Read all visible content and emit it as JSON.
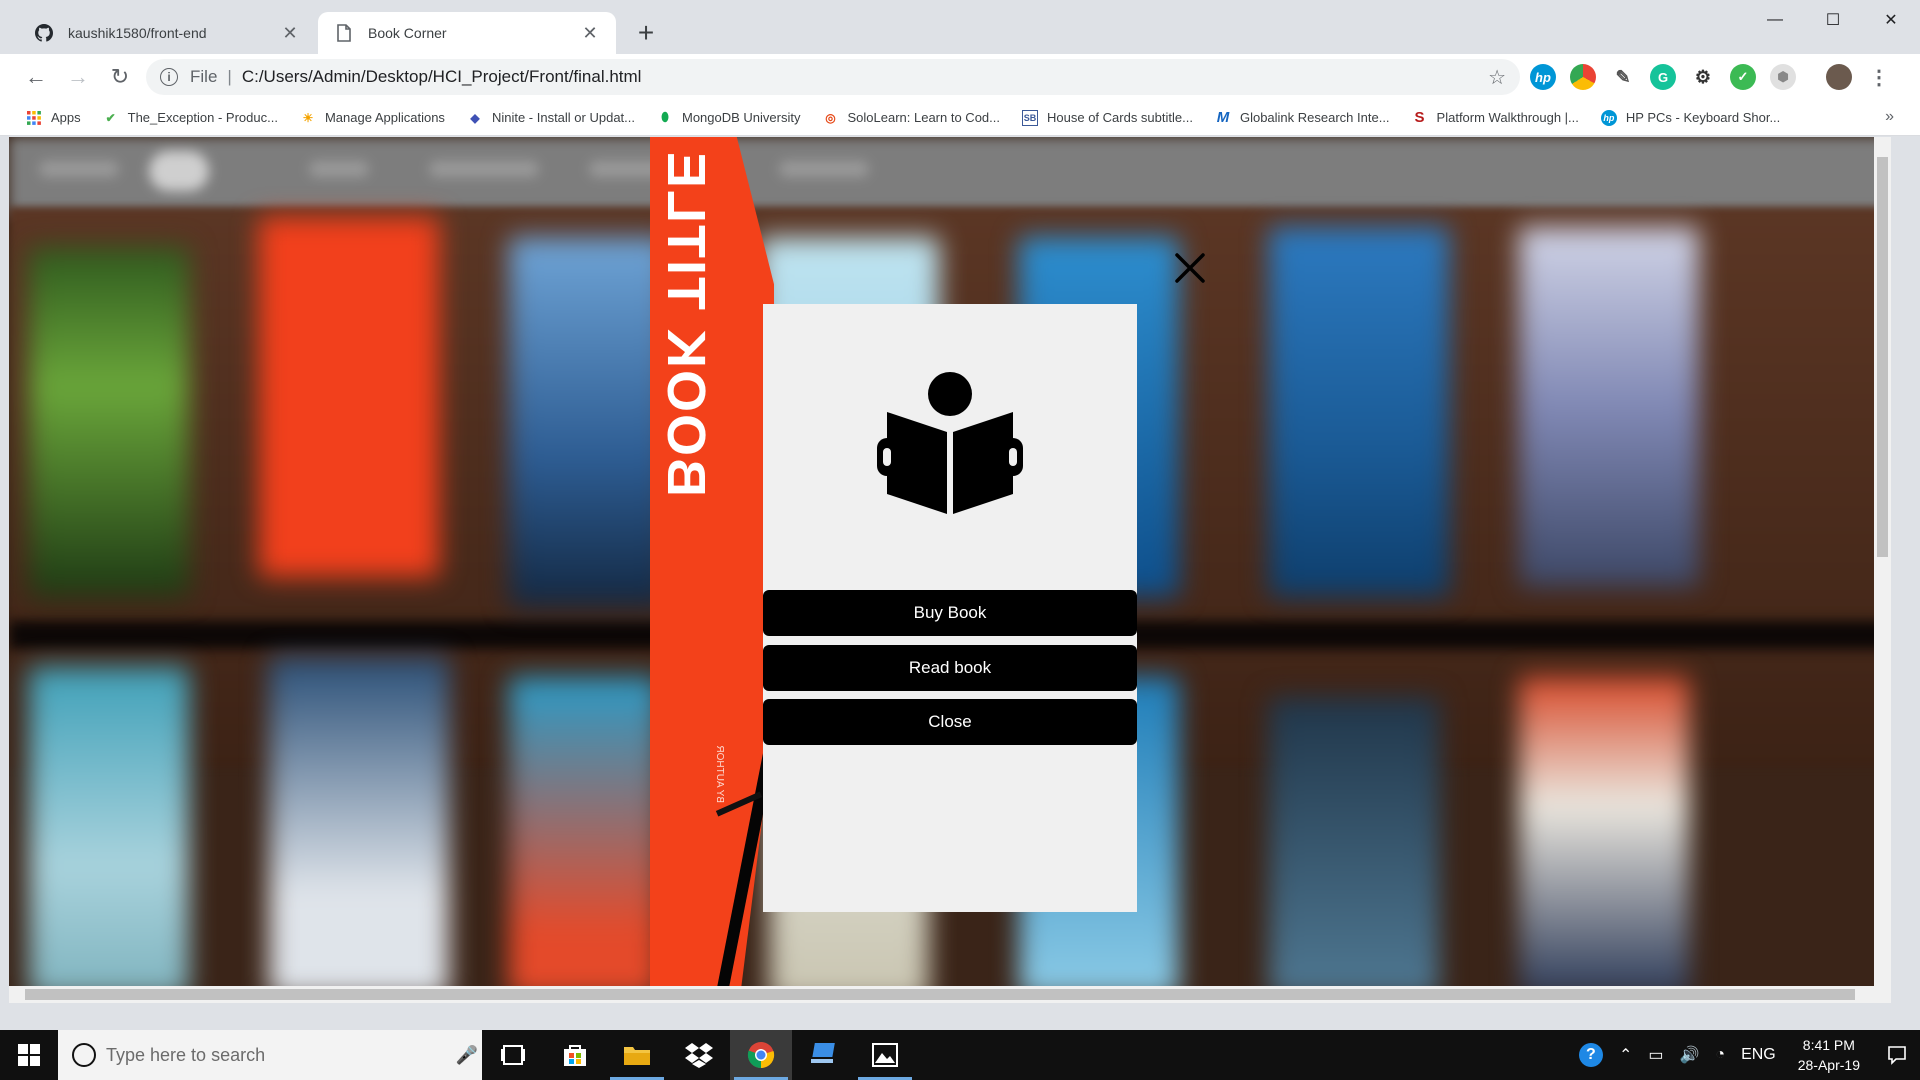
{
  "browser": {
    "tabs": [
      {
        "title": "kaushik1580/front-end",
        "icon": "github-icon"
      },
      {
        "title": "Book Corner",
        "icon": "page-icon"
      }
    ],
    "address": {
      "scheme": "File",
      "url": "C:/Users/Admin/Desktop/HCI_Project/Front/final.html"
    },
    "bookmarks": [
      {
        "label": "Apps",
        "icon": "apps-grid-icon"
      },
      {
        "label": "The_Exception - Produc...",
        "icon": "check-icon"
      },
      {
        "label": "Manage Applications",
        "icon": "sun-icon"
      },
      {
        "label": "Ninite - Install or Updat...",
        "icon": "ninite-icon"
      },
      {
        "label": "MongoDB University",
        "icon": "leaf-icon"
      },
      {
        "label": "SoloLearn: Learn to Cod...",
        "icon": "sololearn-icon"
      },
      {
        "label": "House of Cards subtitle...",
        "icon": "sb-icon"
      },
      {
        "label": "Globalink Research Inte...",
        "icon": "m-icon"
      },
      {
        "label": "Platform Walkthrough |...",
        "icon": "s-icon"
      },
      {
        "label": "HP PCs - Keyboard Shor...",
        "icon": "hp-icon"
      }
    ],
    "colors": {
      "accent": "#4285f4",
      "tabstrip": "#dee1e6"
    }
  },
  "page": {
    "book_cover": {
      "title": "BOOK TITLE",
      "subtitle": "BY AUTHOR",
      "color": "#f3411a"
    },
    "modal": {
      "icon": "reading-person-icon",
      "buttons": [
        {
          "label": "Buy Book"
        },
        {
          "label": "Read book"
        },
        {
          "label": "Close"
        }
      ],
      "close_icon": "close-icon"
    }
  },
  "taskbar": {
    "search_placeholder": "Type here to search",
    "language": "ENG",
    "time": "8:41 PM",
    "date": "28-Apr-19"
  }
}
